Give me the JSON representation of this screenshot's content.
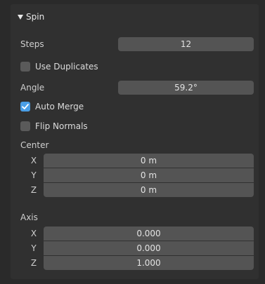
{
  "panel": {
    "title": "Spin",
    "steps": {
      "label": "Steps",
      "value": "12"
    },
    "use_duplicates": {
      "label": "Use Duplicates",
      "checked": false
    },
    "angle": {
      "label": "Angle",
      "value": "59.2°"
    },
    "auto_merge": {
      "label": "Auto Merge",
      "checked": true
    },
    "flip_normals": {
      "label": "Flip Normals",
      "checked": false
    },
    "center": {
      "label": "Center",
      "x": {
        "label": "X",
        "value": "0 m"
      },
      "y": {
        "label": "Y",
        "value": "0 m"
      },
      "z": {
        "label": "Z",
        "value": "0 m"
      }
    },
    "axis": {
      "label": "Axis",
      "x": {
        "label": "X",
        "value": "0.000"
      },
      "y": {
        "label": "Y",
        "value": "0.000"
      },
      "z": {
        "label": "Z",
        "value": "1.000"
      }
    }
  },
  "colors": {
    "background": "#2a2a2a",
    "panel": "#303030",
    "field": "#545454",
    "checkbox_on": "#4a9ee6",
    "checkbox_off": "#5a5a5a"
  }
}
